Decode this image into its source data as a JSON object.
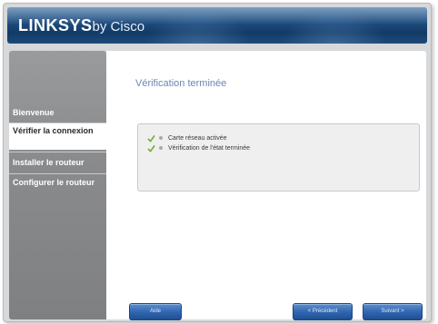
{
  "app": {
    "brand": "LINKSYS",
    "brand_suffix": "by Cisco"
  },
  "sidebar": {
    "items": [
      {
        "label": "Bienvenue"
      },
      {
        "label": "Vérifier la connexion"
      },
      {
        "label": "Installer le routeur"
      },
      {
        "label": "Configurer le routeur"
      }
    ]
  },
  "main": {
    "title": "Vérification terminée",
    "status_items": [
      {
        "label": "Carte réseau activée"
      },
      {
        "label": "Vérification de l'état terminée"
      }
    ]
  },
  "buttons": {
    "help": "Aide",
    "back": "< Précédent",
    "next": "Suivant >"
  },
  "colors": {
    "header": "#1f4e80",
    "sidebar": "#8a8b8d",
    "title": "#6a86b4",
    "button": "#2f64ad",
    "check": "#79a93a"
  }
}
